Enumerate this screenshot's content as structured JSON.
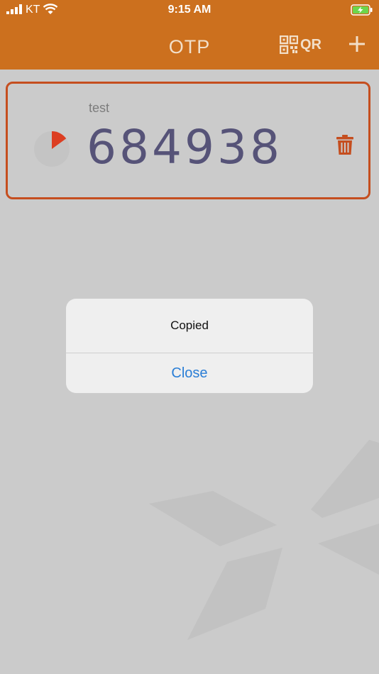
{
  "status_bar": {
    "carrier": "KT",
    "time": "9:15 AM"
  },
  "header": {
    "title": "OTP",
    "qr_label": "QR",
    "qr_icon": "qr-code-icon",
    "add_icon": "plus-icon"
  },
  "otp_entry": {
    "account": "test",
    "code": "684938",
    "timer_remaining_fraction": 0.85,
    "delete_icon": "trash-icon"
  },
  "dialog": {
    "message": "Copied",
    "button_label": "Close"
  },
  "colors": {
    "header": "#cc701e",
    "accent": "#c54e1f",
    "code": "#565378",
    "link": "#2a7ed6",
    "background": "#cbcbcb"
  }
}
